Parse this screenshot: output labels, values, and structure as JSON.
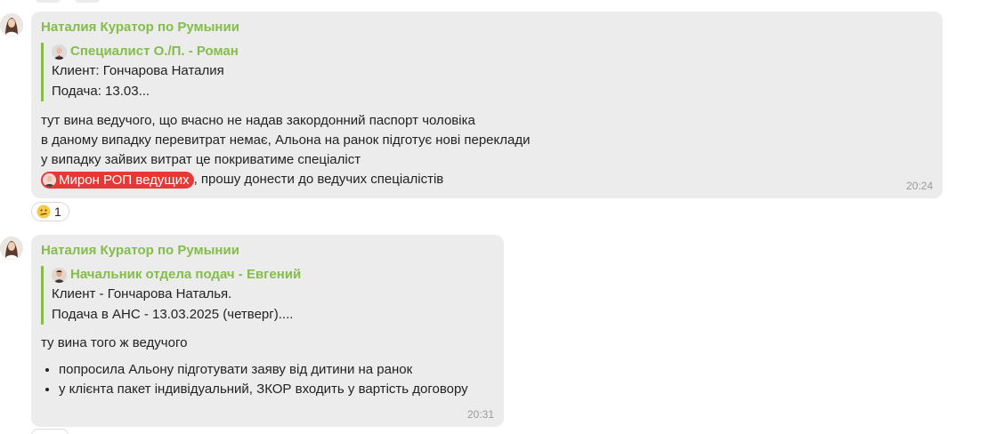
{
  "messages": [
    {
      "sender": "Наталия Куратор по Румынии",
      "quote": {
        "author": "Специалист О./П. - Роман",
        "lines": [
          "Клиент: Гончарова Наталия",
          "Подача: 13.03..."
        ]
      },
      "text_lines": [
        "тут вина ведучого, що вчасно не надав закордонний паспорт чоловіка",
        "в даному випадку перевитрат немає, Альона на ранок підготує нові переклади",
        "у випадку зайвих витрат це покриватиме спеціаліст"
      ],
      "mention": "Мирон РОП ведущих",
      "mention_tail": ", прошу донести до ведучих спеціалістів",
      "time": "20:24",
      "reaction": {
        "emoji": "confused-face-icon",
        "count": "1"
      }
    },
    {
      "sender": "Наталия Куратор по Румынии",
      "quote": {
        "author": "Начальник отдела подач - Евгений",
        "lines": [
          "Клиент - Гончарова Наталья.",
          "Подача в АНС - 13.03.2025 (четверг)...."
        ]
      },
      "text_lines": [
        "ту вина того ж ведучого"
      ],
      "bullets": [
        "попросила Альону підготувати заяву від дитини на ранок",
        "у клієнта пакет індивідуальний, ЗКОР входить у вартість договору"
      ],
      "time": "20:31"
    }
  ],
  "colors": {
    "accent_green": "#84bd4b",
    "bubble_bg": "#ececec",
    "mention_red": "#e53935",
    "time_gray": "#9a9a9a"
  }
}
